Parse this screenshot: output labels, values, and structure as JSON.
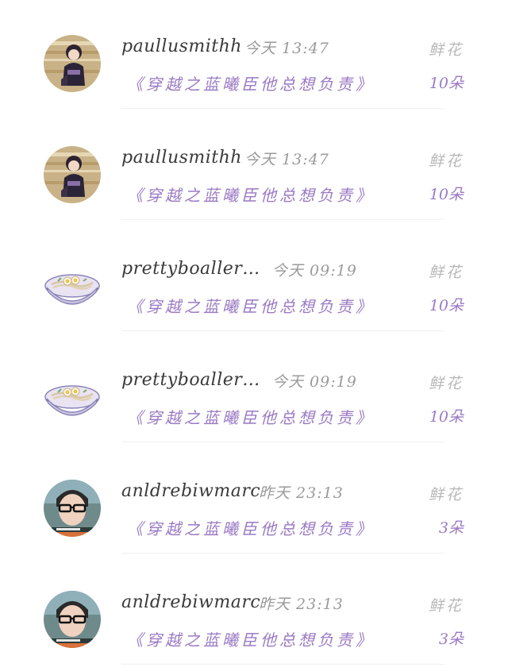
{
  "rows": [
    {
      "avatar": "avatar-anime-character",
      "username": "paullusmithh",
      "time": "今天 13:47",
      "title": "《穿越之蓝曦臣他总想负责》",
      "gift_label": "鲜花",
      "gift_count": "10朵"
    },
    {
      "avatar": "avatar-anime-character",
      "username": "paullusmithh",
      "time": "今天 13:47",
      "title": "《穿越之蓝曦臣他总想负责》",
      "gift_label": "鲜花",
      "gift_count": "10朵"
    },
    {
      "avatar": "avatar-noodle-bowl",
      "username": "prettyboaller…",
      "time": "今天 09:19",
      "title": "《穿越之蓝曦臣他总想负责》",
      "gift_label": "鲜花",
      "gift_count": "10朵"
    },
    {
      "avatar": "avatar-noodle-bowl",
      "username": "prettyboaller…",
      "time": "今天 09:19",
      "title": "《穿越之蓝曦臣他总想负责》",
      "gift_label": "鲜花",
      "gift_count": "10朵"
    },
    {
      "avatar": "avatar-person-glasses",
      "username": "anldrebiwmarc",
      "time": "昨天 23:13",
      "title": "《穿越之蓝曦臣他总想负责》",
      "gift_label": "鲜花",
      "gift_count": "3朵"
    },
    {
      "avatar": "avatar-person-glasses",
      "username": "anldrebiwmarc",
      "time": "昨天 23:13",
      "title": "《穿越之蓝曦臣他总想负责》",
      "gift_label": "鲜花",
      "gift_count": "3朵"
    }
  ],
  "colors": {
    "username": "#3a3a3a",
    "time": "#9a9a9a",
    "accent_purple": "#9a7ac4",
    "gift_label": "#b8b8b8",
    "background": "#ffffff"
  }
}
